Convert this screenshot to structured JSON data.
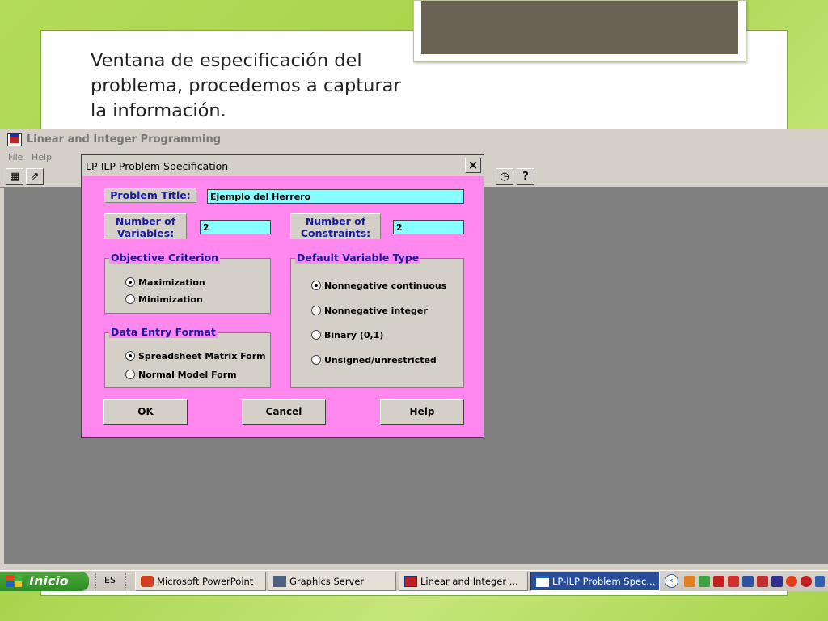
{
  "slide": {
    "text": "Ventana de especificación del problema, procedemos a capturar la información."
  },
  "app": {
    "title": "Linear and Integer Programming",
    "menu": [
      "File",
      "Help"
    ],
    "toolbar_left": [
      {
        "icon": "grid-icon",
        "glyph": "▦"
      },
      {
        "icon": "open-folder-icon",
        "glyph": "⇗"
      }
    ],
    "toolbar_right": [
      {
        "icon": "clock-icon",
        "glyph": "◷"
      },
      {
        "icon": "help-icon",
        "glyph": "?"
      }
    ]
  },
  "dialog": {
    "title": "LP-ILP Problem Specification",
    "close_glyph": "×",
    "problem_title_label": "Problem Title:",
    "problem_title_value": "Ejemplo del Herrero",
    "num_variables_label": "Number of Variables:",
    "num_variables_value": "2",
    "num_constraints_label": "Number of Constraints:",
    "num_constraints_value": "2",
    "objective": {
      "label": "Objective Criterion",
      "options": [
        "Maximization",
        "Minimization"
      ],
      "selected": 0
    },
    "data_entry": {
      "label": "Data Entry Format",
      "options": [
        "Spreadsheet Matrix Form",
        "Normal Model Form"
      ],
      "selected": 0
    },
    "variable_type": {
      "label": "Default Variable Type",
      "options": [
        "Nonnegative continuous",
        "Nonnegative integer",
        "Binary (0,1)",
        "Unsigned/unrestricted"
      ],
      "selected": 0
    },
    "buttons": {
      "ok": "OK",
      "cancel": "Cancel",
      "help": "Help"
    }
  },
  "taskbar": {
    "start_label": "Inicio",
    "language": "ES",
    "tasks": [
      {
        "label": "Microsoft PowerPoint",
        "icon": "powerpoint-icon",
        "color": "#d04020"
      },
      {
        "label": "Graphics Server",
        "icon": "graphics-server-icon",
        "color": "#506080"
      },
      {
        "label": "Linear and Integer ...",
        "icon": "lp-app-icon",
        "color": "#c02020"
      },
      {
        "label": "LP-ILP Problem Spec...",
        "icon": "window-icon",
        "color": "#ffffff"
      }
    ],
    "tray_icons": [
      {
        "name": "security-icon",
        "color": "#e08020"
      },
      {
        "name": "network-icon",
        "color": "#40a040"
      },
      {
        "name": "acrobat-icon",
        "color": "#c02020"
      },
      {
        "name": "pdf-icon",
        "color": "#d03030"
      },
      {
        "name": "display-icon",
        "color": "#3050a0"
      },
      {
        "name": "disconnected-network-icon",
        "color": "#c03030"
      },
      {
        "name": "flag-icon",
        "color": "#303090"
      },
      {
        "name": "update-icon",
        "color": "#e04020"
      },
      {
        "name": "antivirus-icon",
        "color": "#c02020"
      },
      {
        "name": "flash-icon",
        "color": "#b02020"
      },
      {
        "name": "keyboard-icon",
        "color": "#3060b0"
      }
    ]
  }
}
